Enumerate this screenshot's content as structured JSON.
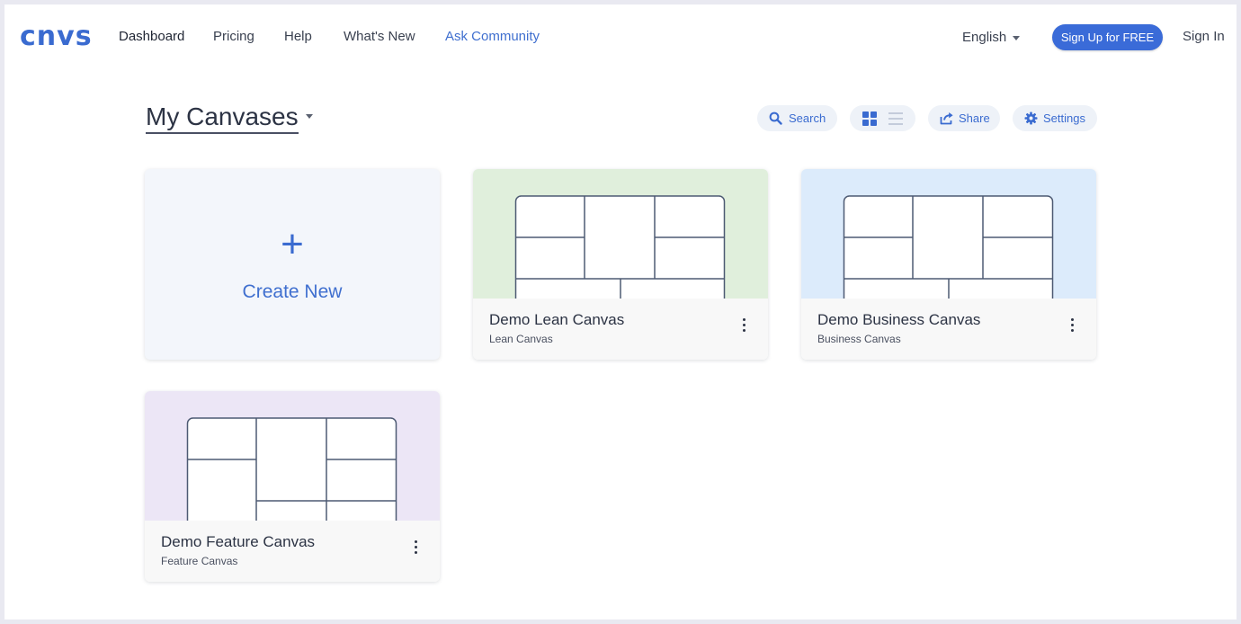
{
  "app": {
    "logo_text": "cnvs",
    "brand_color": "#3a6bd0"
  },
  "nav": {
    "links": [
      {
        "label": "Dashboard",
        "active": true
      },
      {
        "label": "Pricing"
      },
      {
        "label": "Help"
      },
      {
        "label": "What's New"
      },
      {
        "label": "Ask Community",
        "highlight": true
      }
    ],
    "language": "English",
    "signup_label": "Sign Up for FREE",
    "signin_label": "Sign In"
  },
  "header": {
    "title": "My Canvases",
    "search_label": "Search",
    "share_label": "Share",
    "settings_label": "Settings",
    "view_mode": "grid"
  },
  "create_card": {
    "plus": "+",
    "label": "Create New"
  },
  "canvases": [
    {
      "title": "Demo Lean Canvas",
      "type": "Lean Canvas",
      "thumb_color": "#e0efdc"
    },
    {
      "title": "Demo Business Canvas",
      "type": "Business Canvas",
      "thumb_color": "#dcebfb"
    },
    {
      "title": "Demo Feature Canvas",
      "type": "Feature Canvas",
      "thumb_color": "#ece6f6"
    }
  ],
  "icons": {
    "search": "search-icon",
    "grid_view": "grid-view-icon",
    "list_view": "list-view-icon",
    "share": "share-icon",
    "settings": "gear-icon",
    "more": "more-vertical-icon",
    "language_caret": "chevron-down-icon"
  }
}
